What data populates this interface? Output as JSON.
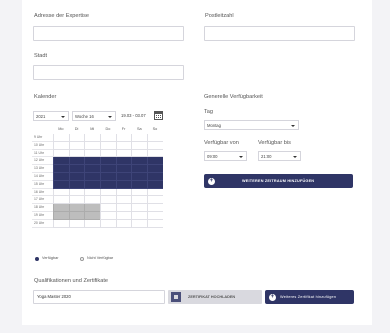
{
  "fields": {
    "address_label": "Adresse der Expertise",
    "postcode_label": "Postleitzahl",
    "city_label": "Stadt"
  },
  "calendar": {
    "label": "Kalender",
    "year": "2021",
    "week": "Woche 16",
    "range": "19.03 - 03.07",
    "days": [
      "Mo",
      "Di",
      "Mi",
      "Do",
      "Fr",
      "Sa",
      "So"
    ],
    "times": [
      "9 Uhr",
      "10 Uhr",
      "11 Uhr",
      "12 Uhr",
      "13 Uhr",
      "14 Uhr",
      "15 Uhr",
      "16 Uhr",
      "17 Uhr",
      "18 Uhr",
      "19 Uhr",
      "20 Uhr"
    ],
    "available_rows": [
      "12 Uhr",
      "13 Uhr",
      "14 Uhr",
      "15 Uhr"
    ],
    "unavailable_rows": [
      "18 Uhr",
      "19 Uhr"
    ],
    "unavailable_days": [
      "Mo",
      "Di",
      "Mi"
    ],
    "legend_available": "Verfügbar",
    "legend_unavailable": "Nicht Verfügbar",
    "colors": {
      "available": "#2f3566",
      "unavailable": "#bdbdbd"
    }
  },
  "availability": {
    "label": "Generelle Verfügbarkeit",
    "day_label": "Tag",
    "day_value": "Montag",
    "from_label": "Verfügbar von",
    "to_label": "Verfügbar bis",
    "from_value": "09:00",
    "to_value": "21:00",
    "add_button": "WEITEREN ZEITRAUM HINZUFÜGEN"
  },
  "qualifications": {
    "label": "Qualifikationen und Zertifikate",
    "input_value": "Yoga Master 2020",
    "upload_button": "ZERTIFIKAT HOCHLADEN",
    "add_button": "Weiteres Zertifikat hinzufügen"
  }
}
